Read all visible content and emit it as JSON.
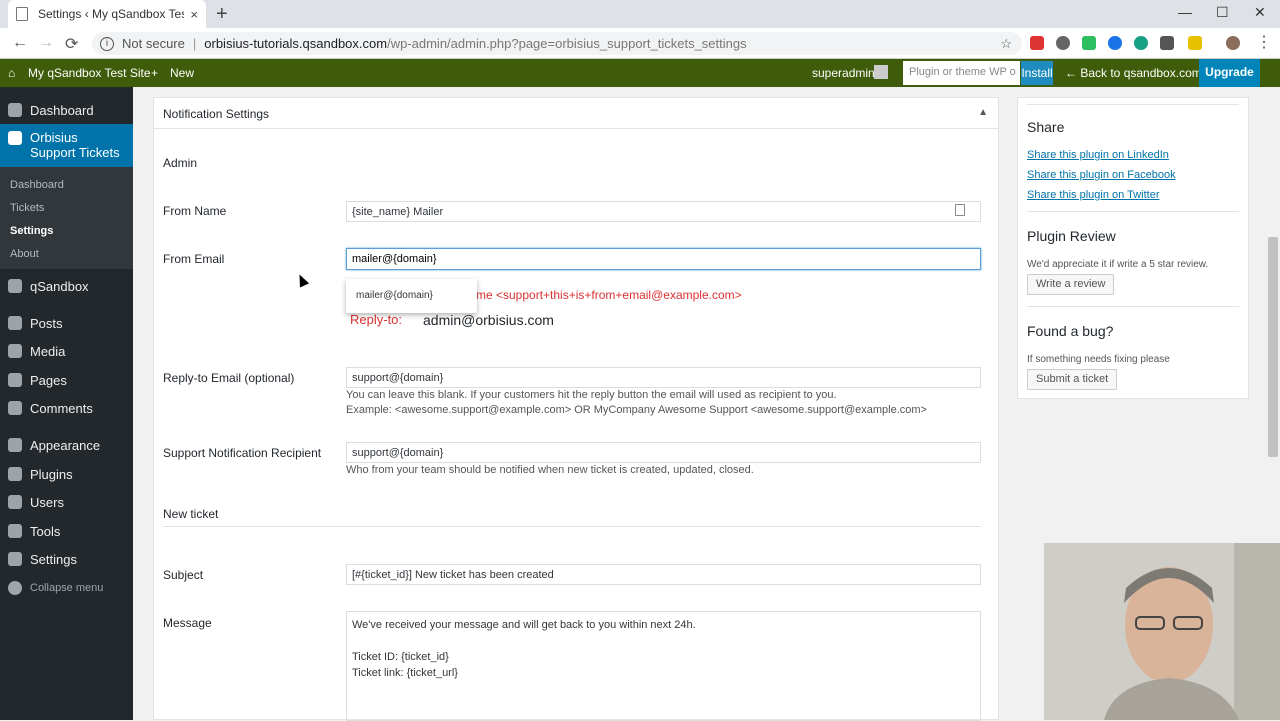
{
  "browser": {
    "tab_title": "Settings ‹ My qSandbox Test Site",
    "tab_close": "×",
    "new_tab": "+",
    "security": "Not secure",
    "url_host": "orbisius-tutorials.qsandbox.com",
    "url_path": "/wp-admin/admin.php?page=orbisius_support_tickets_settings",
    "back": "←",
    "forward": "→",
    "reload": "⟳",
    "star": "☆",
    "minimize": "—",
    "maximize": "☐",
    "close": "✕"
  },
  "adminbar": {
    "site_name": "My qSandbox Test Site",
    "new_label": "New",
    "user": "superadmin",
    "search_placeholder": "Plugin or theme WP o",
    "install": "Install",
    "back_link": "← Back to qsandbox.com",
    "upgrade": "Upgrade"
  },
  "sidebar": {
    "dashboard": "Dashboard",
    "plugin_menu": "Orbisius Support Tickets",
    "sub_dashboard": "Dashboard",
    "sub_tickets": "Tickets",
    "sub_settings": "Settings",
    "sub_about": "About",
    "qsandbox": "qSandbox",
    "posts": "Posts",
    "media": "Media",
    "pages": "Pages",
    "comments": "Comments",
    "appearance": "Appearance",
    "plugins": "Plugins",
    "users": "Users",
    "tools": "Tools",
    "settings": "Settings",
    "collapse": "Collapse menu"
  },
  "panel": {
    "title": "Notification Settings",
    "toggle": "▲",
    "admin_heading": "Admin",
    "from_name_label": "From Name",
    "from_name_value": "{site_name} Mailer",
    "from_email_label": "From Email",
    "from_email_value": "mailer@{domain}",
    "autocomplete_option": "mailer@{domain}",
    "red_hint": "me  <support+this+is+from+email@example.com>",
    "replyto_label": "Reply-to:",
    "replyto_value": "admin@orbisius.com",
    "reply_email_label": "Reply-to Email (optional)",
    "reply_email_value": "support@{domain}",
    "reply_desc_1": "You can leave this blank. If your customers hit the reply button the email will used as recipient to you.",
    "reply_desc_2": "Example: <awesome.support@example.com> OR MyCompany Awesome Support <awesome.support@example.com>",
    "recipient_label": "Support Notification Recipient",
    "recipient_value": "support@{domain}",
    "recipient_desc": "Who from your team should be notified when new ticket is created, updated, closed.",
    "new_ticket_heading": "New ticket",
    "subject_label": "Subject",
    "subject_value": "[#{ticket_id}] New ticket has been created",
    "message_label": "Message",
    "message_line1": "We've received your message and will get back to you within next 24h.",
    "message_line2": "Ticket ID: {ticket_id}",
    "message_line3": "Ticket link: {ticket_url}"
  },
  "right": {
    "share_heading": "Share",
    "share_linkedin": "Share this plugin on LinkedIn",
    "share_facebook": "Share this plugin on Facebook",
    "share_twitter": "Share this plugin on Twitter",
    "review_heading": "Plugin Review",
    "review_text": "We'd appreciate it if write a 5 star review.",
    "review_button": "Write a review",
    "bug_heading": "Found a bug?",
    "bug_text": "If something needs fixing please",
    "bug_button": "Submit a ticket"
  },
  "colors": {
    "adminbar": "#3e5c0a",
    "sidebar": "#23282d",
    "active_menu": "#0073aa",
    "link": "#0073aa",
    "error_red": "#dc3232"
  }
}
